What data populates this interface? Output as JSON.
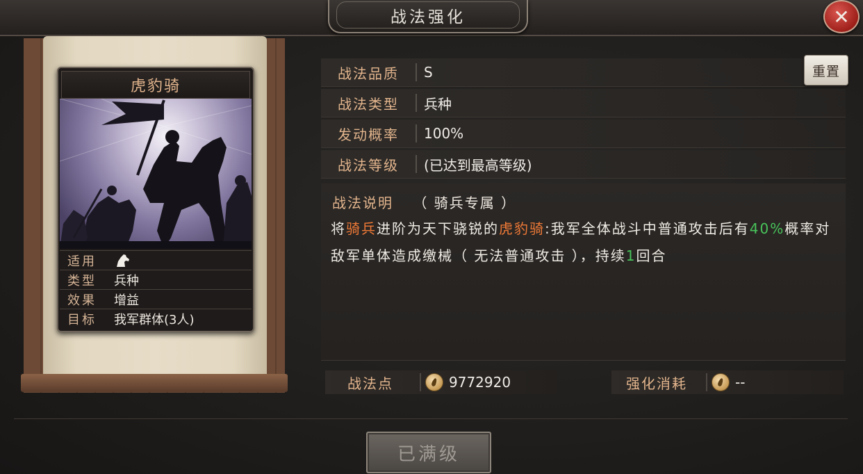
{
  "window": {
    "title": "战法强化",
    "close_icon": "close-icon"
  },
  "card": {
    "name": "虎豹骑",
    "stats": [
      {
        "label": "适用",
        "value": "",
        "icon": "horse-icon"
      },
      {
        "label": "类型",
        "value": "兵种"
      },
      {
        "label": "效果",
        "value": "增益"
      },
      {
        "label": "目标",
        "value": "我军群体(3人)"
      }
    ]
  },
  "info": {
    "quality_label": "战法品质",
    "quality_value": "S",
    "type_label": "战法类型",
    "type_value": "兵种",
    "rate_label": "发动概率",
    "rate_value": "100%",
    "level_label": "战法等级",
    "level_value": "(已达到最高等级)",
    "reset_label": "重置"
  },
  "description": {
    "label": "战法说明",
    "subtitle": "（ 骑兵专属 ）",
    "text_1": "将",
    "text_unit": "骑兵",
    "text_2": "进阶为天下骁锐的",
    "text_name": "虎豹骑",
    "text_3": ":我军全体战斗中普通攻击后有",
    "text_pct": "40%",
    "text_4": "概率对敌军单体造成缴械（ 无法普通攻击 ），持续",
    "text_turns": "1",
    "text_5": "回合"
  },
  "points": {
    "label": "战法点",
    "value": "9772920",
    "cost_label": "强化消耗",
    "cost_value": "--"
  },
  "footer": {
    "max_button": "已满级"
  },
  "colors": {
    "label_gold": "#e3b58d",
    "highlight_orange": "#f07a36",
    "highlight_green": "#48c45a"
  }
}
